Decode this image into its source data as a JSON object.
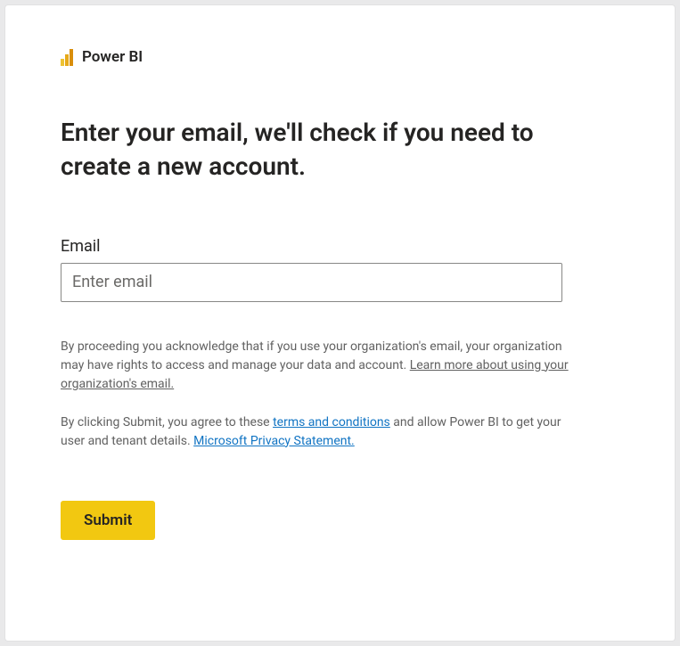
{
  "brand": {
    "name": "Power BI",
    "icon": "powerbi-icon"
  },
  "heading": "Enter your email, we'll check if you need to create a new account.",
  "form": {
    "email_label": "Email",
    "email_placeholder": "Enter email",
    "email_value": ""
  },
  "disclaimer1": {
    "text_a": "By proceeding you acknowledge that if you use your organization's email, your organization may have rights to access and manage your data and account. ",
    "link": "Learn more about using your organization's email."
  },
  "disclaimer2": {
    "text_a": "By clicking Submit, you agree to these ",
    "link_terms": "terms and conditions",
    "text_b": " and allow Power BI to get your user and tenant details. ",
    "link_privacy": "Microsoft Privacy Statement."
  },
  "buttons": {
    "submit": "Submit"
  },
  "colors": {
    "accent": "#f2c811",
    "link_blue": "#1174c3",
    "text_primary": "#252423",
    "text_secondary": "#616161"
  }
}
